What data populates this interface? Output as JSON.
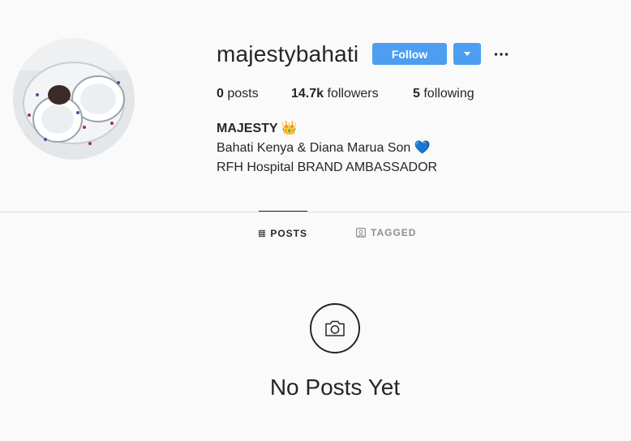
{
  "profile": {
    "username": "majestybahati",
    "follow_label": "Follow",
    "avatar_alt": "profile picture"
  },
  "stats": {
    "posts_count": "0",
    "posts_label": "posts",
    "followers_count": "14.7k",
    "followers_label": "followers",
    "following_count": "5",
    "following_label": "following"
  },
  "bio": {
    "name": "MAJESTY 👑",
    "line1": "Bahati Kenya & Diana Marua Son 💙",
    "line2": "RFH Hospital BRAND AMBASSADOR"
  },
  "tabs": [
    {
      "label": "POSTS",
      "icon": "grid-icon",
      "active": true
    },
    {
      "label": "TAGGED",
      "icon": "tag-portrait-icon",
      "active": false
    }
  ],
  "empty_state": {
    "icon": "camera-icon",
    "title": "No Posts Yet"
  },
  "colors": {
    "accent": "#4d9ef0",
    "background": "#fafafa",
    "text": "#262626",
    "muted": "#8e8e8e",
    "divider": "#dbdbdb"
  }
}
